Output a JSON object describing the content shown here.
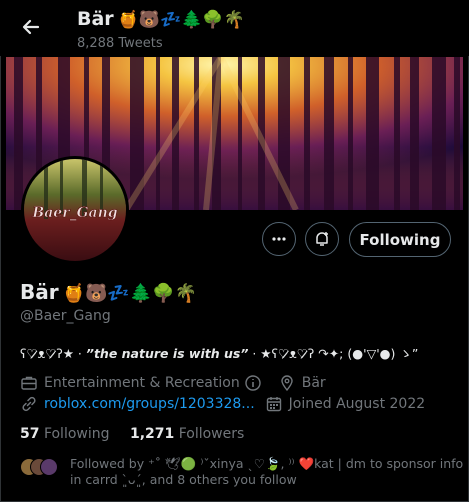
{
  "header": {
    "title": "Bär",
    "title_emoji": "🍯🐻💤🌲🌳🌴",
    "tweet_count": "8,288 Tweets"
  },
  "profile": {
    "avatar_text": "Baer_Gang",
    "name": "Bär",
    "name_emoji": "🍯🐻💤🌲🌳🌴",
    "handle": "@Baer_Gang",
    "bio_prefix": "ʕ♡̷̷ᴥ♡̷̷ʔ★ · ",
    "bio_quote": "”the nature is with us”",
    "bio_suffix": " · ★ʕ♡̷̷ᴥ♡̷̷ʔ    ↷✦; (●'▽'●) ゝ”",
    "category": "Entertainment & Recreation",
    "location": "Bär",
    "website": "roblox.com/groups/1203328...",
    "joined": "Joined August 2022",
    "following_count": "57",
    "following_label": "Following",
    "followers_count": "1,271",
    "followers_label": "Followers",
    "followed_by": "Followed by ⁺˚ 🕊🟢 ⁾ˇxinya ˎ♡🍃, ⁾⁾ ❤️kat | dm to sponsor info in carrd ˋ͈ᴗˊ͈, and 8 others you follow"
  },
  "actions": {
    "follow_state": "Following"
  },
  "colors": {
    "background": "#000000",
    "text": "#e7e9ea",
    "muted": "#71767b",
    "link": "#1d9bf0",
    "border": "#536471"
  },
  "icons": [
    "back-arrow-icon",
    "more-icon",
    "notification-bell-icon",
    "briefcase-icon",
    "info-icon",
    "location-pin-icon",
    "link-icon",
    "calendar-icon"
  ]
}
